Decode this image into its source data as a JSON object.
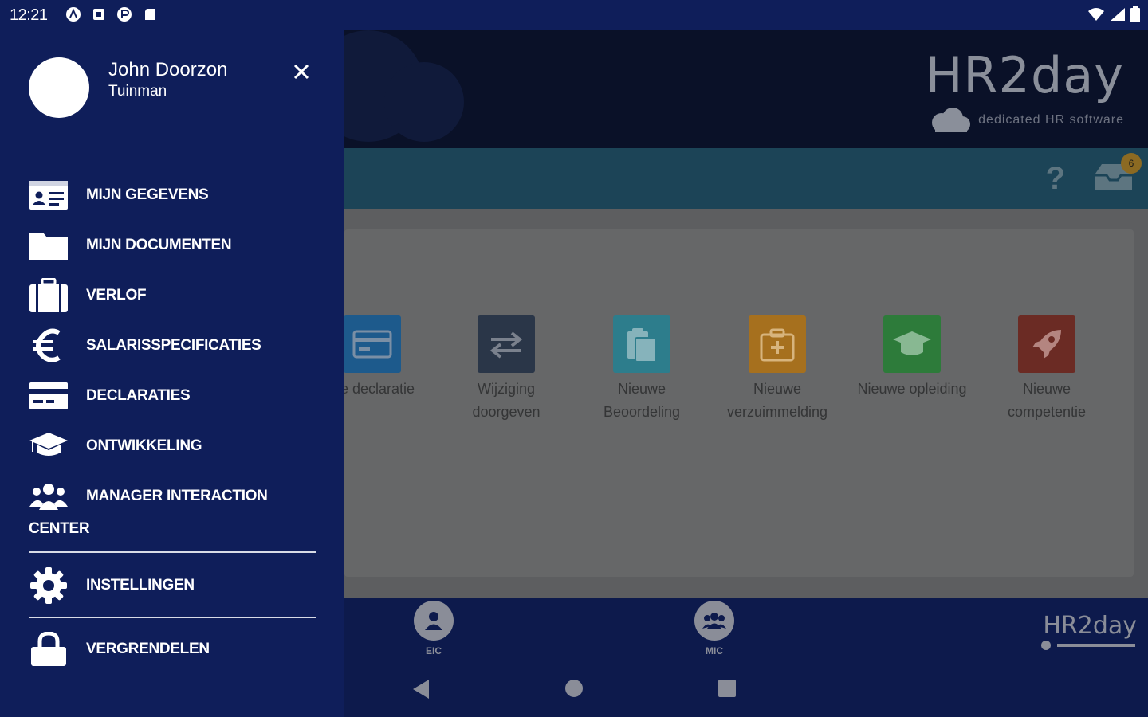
{
  "status_bar": {
    "time": "12:21",
    "left_icons": [
      "nfc-icon",
      "app-notification-icon",
      "app-icon",
      "sd-card-icon"
    ],
    "right_icons": [
      "wifi-icon",
      "signal-icon",
      "battery-icon"
    ]
  },
  "drawer": {
    "user_name": "John Doorzon",
    "user_role": "Tuinman",
    "menu": [
      {
        "label": "MIJN GEGEVENS",
        "icon": "id-card-icon"
      },
      {
        "label": "MIJN DOCUMENTEN",
        "icon": "folder-icon"
      },
      {
        "label": "VERLOF",
        "icon": "suitcase-icon"
      },
      {
        "label": "SALARISSPECIFICATIES",
        "icon": "euro-icon"
      },
      {
        "label": "DECLARATIES",
        "icon": "credit-card-icon"
      },
      {
        "label": "ONTWIKKELING",
        "icon": "graduation-cap-icon"
      },
      {
        "label": "MANAGER INTERACTION",
        "label2": "CENTER",
        "icon": "users-icon"
      }
    ],
    "settings_label": "INSTELLINGEN",
    "lock_label": "VERGRENDELEN"
  },
  "app": {
    "logo_text": "HR2day",
    "logo_tagline": "dedicated HR software",
    "inbox_badge": "6",
    "help_glyph": "?",
    "tiles": [
      {
        "label1": "we declaratie",
        "label2": "",
        "color": "#1d5a8c",
        "icon": "credit-card-icon"
      },
      {
        "label1": "Wijziging",
        "label2": "doorgeven",
        "color": "#2a3648",
        "icon": "swap-arrows-icon"
      },
      {
        "label1": "Nieuwe",
        "label2": "Beoordeling",
        "color": "#2d7d8c",
        "icon": "clipboard-icon"
      },
      {
        "label1": "Nieuwe",
        "label2": "verzuimmelding",
        "color": "#a6701e",
        "icon": "medkit-icon"
      },
      {
        "label1": "Nieuwe opleiding",
        "label2": "",
        "color": "#2d7b3a",
        "icon": "graduation-cap-icon"
      },
      {
        "label1": "Nieuwe",
        "label2": "competentie",
        "color": "#6b2b24",
        "icon": "rocket-icon"
      }
    ],
    "bottom_nav": [
      {
        "label": "EIC",
        "icon": "user-icon"
      },
      {
        "label": "MIC",
        "icon": "users-icon"
      }
    ],
    "footer_logo": "HR2day"
  },
  "colors": {
    "drawer_bg": "#0f1e5a",
    "header_bg": "#0a1128",
    "toolbar_bg": "#1c4457"
  }
}
